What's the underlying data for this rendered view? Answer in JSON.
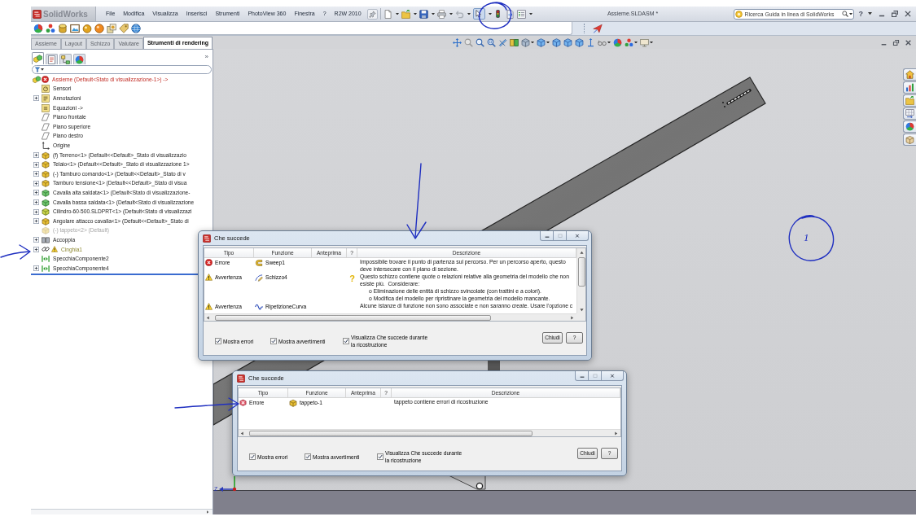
{
  "menu_bar": {
    "logo": "SolidWorks",
    "menus": [
      "File",
      "Modifica",
      "Visualizza",
      "Inserisci",
      "Strumenti",
      "PhotoView 360",
      "Finestra",
      "?",
      "R2W 2010"
    ],
    "document_title": "Assieme.SLDASM *",
    "search": {
      "placeholder": "Ricerca Guida in linea di SolidWorks"
    },
    "help": "?"
  },
  "command_tabs": [
    {
      "label": "Assieme",
      "selected": false
    },
    {
      "label": "Layout",
      "selected": false
    },
    {
      "label": "Schizzo",
      "selected": false
    },
    {
      "label": "Valutare",
      "selected": false
    },
    {
      "label": "Strumenti di rendering",
      "selected": true
    }
  ],
  "feature_manager": {
    "tabs": [
      {
        "kind": "features",
        "selected": true
      },
      {
        "kind": "properties",
        "selected": false
      },
      {
        "kind": "configurations",
        "selected": false
      },
      {
        "kind": "appearance",
        "selected": false
      }
    ],
    "more": "»",
    "root": {
      "label": "Assieme (Default<Stato di visualizzazione-1>) ->",
      "error": true
    },
    "items": [
      {
        "label": "Sensori",
        "kind": "sensor",
        "expandable": false,
        "suppressed": false,
        "warning": false
      },
      {
        "label": "Annotazioni",
        "kind": "annotation",
        "expandable": true,
        "suppressed": false,
        "warning": false
      },
      {
        "label": "Equazioni ->",
        "kind": "equation",
        "expandable": false,
        "suppressed": false,
        "warning": false
      },
      {
        "label": "Piano frontale",
        "kind": "plane",
        "expandable": false,
        "suppressed": false,
        "warning": false
      },
      {
        "label": "Piano superiore",
        "kind": "plane",
        "expandable": false,
        "suppressed": false,
        "warning": false
      },
      {
        "label": "Piano destro",
        "kind": "plane",
        "expandable": false,
        "suppressed": false,
        "warning": false
      },
      {
        "label": "Origine",
        "kind": "origin",
        "expandable": false,
        "suppressed": false,
        "warning": false
      },
      {
        "label": "(f) Terreno<1> (Default<<Default>_Stato di visualizzazio",
        "kind": "part",
        "expandable": true,
        "suppressed": false,
        "warning": false
      },
      {
        "label": "Telaio<1> (Default<<Default>_Stato di visualizzazione 1>",
        "kind": "part",
        "expandable": true,
        "suppressed": false,
        "warning": false
      },
      {
        "label": "(-) Tamburo comando<1> (Default<<Default>_Stato di v",
        "kind": "part",
        "expandable": true,
        "suppressed": false,
        "warning": false
      },
      {
        "label": "Tamburo tensione<1> (Default<<Default>_Stato di visua",
        "kind": "part",
        "expandable": true,
        "suppressed": false,
        "warning": false
      },
      {
        "label": "Cavalla alta saldata<1> (Default<Stato di visualizzazione-",
        "kind": "weldment",
        "expandable": true,
        "suppressed": false,
        "warning": false
      },
      {
        "label": "Cavalla bassa saldata<1> (Default<Stato di visualizzazione",
        "kind": "weldment",
        "expandable": true,
        "suppressed": false,
        "warning": false
      },
      {
        "label": "Cilindro-60-500.SLDPRT<1> (Default<Stato di visualizzazi",
        "kind": "part-file",
        "expandable": true,
        "suppressed": false,
        "warning": false
      },
      {
        "label": "Angolare attacco cavalla<1> (Default<<Default>_Stato di",
        "kind": "part",
        "expandable": true,
        "suppressed": false,
        "warning": false
      },
      {
        "label": "(-) tappeto<2> (Default)",
        "kind": "part",
        "expandable": false,
        "suppressed": true,
        "warning": false
      },
      {
        "label": "Accoppia",
        "kind": "mates",
        "expandable": true,
        "suppressed": false,
        "warning": false
      },
      {
        "label": "Cinghia1",
        "kind": "belt",
        "expandable": true,
        "suppressed": false,
        "warning": true
      },
      {
        "label": "SpecchiaComponente2",
        "kind": "mirror",
        "expandable": false,
        "suppressed": false,
        "warning": false
      },
      {
        "label": "SpecchiaComponente4",
        "kind": "mirror",
        "expandable": true,
        "suppressed": false,
        "warning": false
      }
    ]
  },
  "graphics": {
    "triad_label": "Z"
  },
  "dialogs": [
    {
      "title": "Che succede",
      "window_buttons": [
        {
          "kind": "minimize",
          "disabled": false
        },
        {
          "kind": "maximize",
          "disabled": true
        },
        {
          "kind": "close",
          "disabled": false
        }
      ],
      "columns": [
        "Tipo",
        "Funzione",
        "Anteprima",
        "?",
        "Descrizione"
      ],
      "rows": [
        {
          "type": {
            "kind": "error",
            "label": "Errore"
          },
          "feature": {
            "kind": "sweep",
            "label": "Sweep1"
          },
          "description": [
            "Impossibile trovare il punto di partenza sul percorso. Per un percorso aperto, questo",
            "deve intersecare con il piano di sezione."
          ]
        },
        {
          "type": {
            "kind": "warning",
            "label": "Avvertenza"
          },
          "feature": {
            "kind": "sketch",
            "label": "Schizzo4"
          },
          "help_mark": "?",
          "description": [
            "Questo schizzo contiene quote o relazioni relative alla geometria del modello che non",
            "esiste più.  Considerare:"
          ],
          "bullets": [
            "o Eliminazione delle entità di schizzo svincolate (con trattini e a colori).",
            "o Modifica del modello per ripristinare la geometria del modello mancante."
          ]
        },
        {
          "type": {
            "kind": "warning",
            "label": "Avvertenza"
          },
          "feature": {
            "kind": "curve-pattern",
            "label": "RipetizioneCurva"
          },
          "description": [
            "Alcune istanze di funzione non sono associate e non saranno create. Usare l'opzione c"
          ]
        }
      ],
      "options": [
        {
          "label": "Mostra errori",
          "checked": true
        },
        {
          "label": "Mostra avvertimenti",
          "checked": true
        },
        {
          "label": "Visualizza Che succede durante la ricostruzione",
          "checked": true
        }
      ],
      "buttons": [
        "Chiudi",
        "?"
      ]
    },
    {
      "title": "Che succede",
      "window_buttons": [
        {
          "kind": "minimize",
          "disabled": false
        },
        {
          "kind": "maximize",
          "disabled": true
        },
        {
          "kind": "close",
          "disabled": false
        }
      ],
      "columns": [
        "Tipo",
        "Funzione",
        "Anteprima",
        "?",
        "Descrizione"
      ],
      "rows": [
        {
          "type": {
            "kind": "component-error",
            "label": "Errore"
          },
          "feature": {
            "kind": "component",
            "label": "tappeto-1"
          },
          "description": [
            "tappeto contiene errori di ricostruzione"
          ]
        }
      ],
      "options": [
        {
          "label": "Mostra errori",
          "checked": true
        },
        {
          "label": "Mostra avvertimenti",
          "checked": true
        },
        {
          "label": "Visualizza Che succede durante la ricostruzione",
          "checked": true
        }
      ],
      "buttons": [
        "Chiudi",
        "?"
      ]
    }
  ],
  "ink_annotations": [
    {
      "kind": "circle"
    },
    {
      "kind": "arrow"
    },
    {
      "kind": "arrow"
    },
    {
      "kind": "arrow"
    },
    {
      "kind": "circle",
      "label": "1"
    }
  ]
}
